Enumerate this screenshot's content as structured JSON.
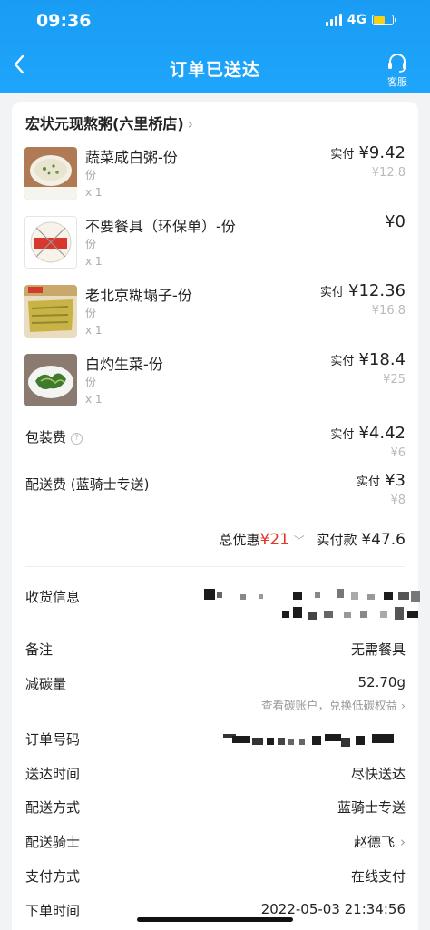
{
  "status": {
    "time": "09:36",
    "network": "4G"
  },
  "nav": {
    "back_icon": "chevron-left-icon",
    "title": "订单已送达",
    "service_label": "客服"
  },
  "shop": {
    "name": "宏状元现熬粥(六里桥店)",
    "chevron": "›"
  },
  "items": [
    {
      "name": "蔬菜咸白粥-份",
      "unit": "份",
      "qty": "x 1",
      "paid_label": "实付",
      "price": "¥9.42",
      "orig": "¥12.8"
    },
    {
      "name": "不要餐具（环保单）-份",
      "unit": "份",
      "qty": "x 1",
      "paid_label": "",
      "price": "¥0",
      "orig": ""
    },
    {
      "name": "老北京糊塌子-份",
      "unit": "份",
      "qty": "x 1",
      "paid_label": "实付",
      "price": "¥12.36",
      "orig": "¥16.8"
    },
    {
      "name": "白灼生菜-份",
      "unit": "份",
      "qty": "x 1",
      "paid_label": "实付",
      "price": "¥18.4",
      "orig": "¥25"
    }
  ],
  "fees": [
    {
      "name": "包装费",
      "paid_label": "实付",
      "price": "¥4.42",
      "orig": "¥6"
    },
    {
      "name": "配送费 (蓝骑士专送)",
      "paid_label": "实付",
      "price": "¥3",
      "orig": "¥8"
    }
  ],
  "total": {
    "discount_label": "总优惠",
    "discount": "¥21",
    "paid_label": "实付款",
    "paid": "¥47.6"
  },
  "info": {
    "address_label": "收货信息",
    "note_label": "备注",
    "note_value": "无需餐具",
    "carbon_label": "减碳量",
    "carbon_value": "52.70g",
    "carbon_link": "查看碳账户，兑换低碳权益",
    "order_no_label": "订单号码",
    "delivery_time_label": "送达时间",
    "delivery_time_value": "尽快送达",
    "delivery_method_label": "配送方式",
    "delivery_method_value": "蓝骑士专送",
    "rider_label": "配送骑士",
    "rider_value": "赵德飞",
    "payment_label": "支付方式",
    "payment_value": "在线支付",
    "order_time_label": "下单时间",
    "order_time_value": "2022-05-03 21:34:56"
  },
  "colors": {
    "header": "#1ea5fb",
    "discount": "#e0382f",
    "background": "#f2f3f5"
  }
}
